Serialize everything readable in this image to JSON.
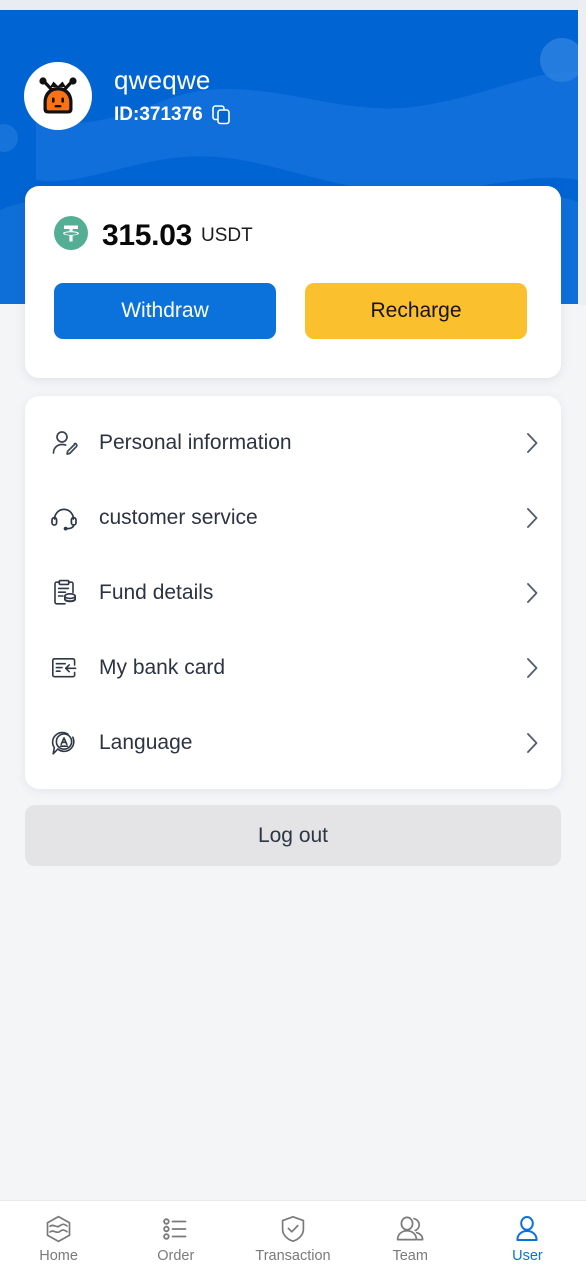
{
  "header": {
    "username": "qweqwe",
    "id_label": "ID:371376",
    "copy_icon": "copy-icon",
    "avatar_icon": "robot-avatar",
    "bg_color": "#0064d2",
    "wave_color": "#1573dc"
  },
  "balance": {
    "token_icon": "usdt-tether-icon",
    "token_color": "#53ae94",
    "amount": "315.03",
    "unit": "USDT",
    "withdraw_label": "Withdraw",
    "withdraw_color": "#0a72da",
    "recharge_label": "Recharge",
    "recharge_color": "#fbc02d"
  },
  "menu": {
    "items": [
      {
        "label": "Personal information",
        "icon": "user-edit-icon"
      },
      {
        "label": "customer service",
        "icon": "headset-icon"
      },
      {
        "label": "Fund details",
        "icon": "clipboard-coins-icon"
      },
      {
        "label": "My bank card",
        "icon": "bank-card-icon"
      },
      {
        "label": "Language",
        "icon": "language-bubble-icon"
      }
    ]
  },
  "logout": {
    "label": "Log out"
  },
  "bottom_nav": {
    "active_color": "#0a72da",
    "inactive_color": "#7a7a7a",
    "items": [
      {
        "label": "Home",
        "icon": "hexagon-home-icon",
        "active": false
      },
      {
        "label": "Order",
        "icon": "list-order-icon",
        "active": false
      },
      {
        "label": "Transaction",
        "icon": "shield-check-icon",
        "active": false
      },
      {
        "label": "Team",
        "icon": "people-team-icon",
        "active": false
      },
      {
        "label": "User",
        "icon": "user-person-icon",
        "active": true
      }
    ]
  }
}
